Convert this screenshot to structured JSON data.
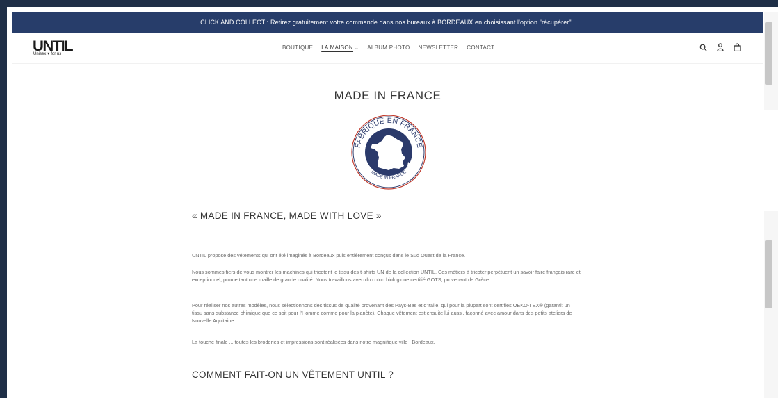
{
  "announcement": "CLICK AND COLLECT : Retirez gratuitement votre commande dans nos bureaux à BORDEAUX en choisissant l'option \"récupérer\" !",
  "logo": {
    "text": "UNTIL",
    "tagline": "Unisex ♥ for us"
  },
  "nav": [
    {
      "label": "BOUTIQUE",
      "active": false
    },
    {
      "label": "LA MAISON",
      "active": true,
      "has_dropdown": true
    },
    {
      "label": "ALBUM PHOTO",
      "active": false
    },
    {
      "label": "NEWSLETTER",
      "active": false
    },
    {
      "label": "CONTACT",
      "active": false
    }
  ],
  "header_icons": [
    "search-icon",
    "account-icon",
    "cart-icon"
  ],
  "page_title": "MADE IN FRANCE",
  "badge": {
    "top_text": "FABRIQUÉ EN FRANCE",
    "bottom_text": "MADE IN FRANCE"
  },
  "sections": [
    {
      "title": "« MADE IN FRANCE, MADE WITH LOVE »",
      "paragraphs": [
        "UNTIL propose des vêtements qui ont été imaginés à Bordeaux puis entièrement conçus dans le Sud Ouest de la France.",
        "Nous sommes fiers de vous montrer les machines qui tricotent le tissu des t-shirts UN de la collection UNTIL. Ces métiers à tricoter perpétuent un savoir faire français rare et exceptionnel, promettant une maille de grande qualité. Nous travaillons avec du coton biologique certifié GOTS, provenant de Grèce.",
        "Pour réaliser nos autres modèles, nous sélectionnons des tissus de qualité provenant des Pays-Bas et d'Italie, qui pour la plupart sont certifiés OEKO-TEX® (garantit un tissu sans substance chimique que ce soit pour l'Homme comme pour la planète). Chaque vêtement est ensuite lui aussi, façonné avec amour dans des petits ateliers de Nouvelle Aquitaine.",
        "La touche finale ... toutes les broderies et impressions sont réalisées dans notre magnifique ville : Bordeaux."
      ]
    },
    {
      "title": "COMMENT FAIT-ON UN VÊTEMENT UNTIL ?"
    }
  ],
  "colors": {
    "announcement_bg": "#273d6a",
    "frame": "#1f2f47",
    "badge_navy": "#2b3a6b",
    "badge_red": "#c0392b"
  }
}
